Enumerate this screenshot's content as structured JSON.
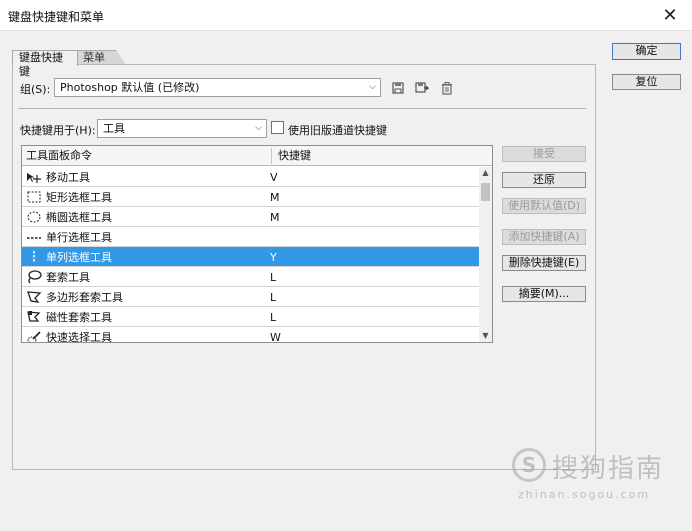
{
  "window": {
    "title": "键盘快捷键和菜单",
    "close_glyph": "✕"
  },
  "tabs": [
    {
      "label": "键盘快捷键",
      "active": true
    },
    {
      "label": "菜单",
      "active": false
    }
  ],
  "side_buttons": {
    "ok": "确定",
    "reset": "复位"
  },
  "group": {
    "label": "组(S):",
    "value": "Photoshop 默认值 (已修改)"
  },
  "shortcuts_for": {
    "label": "快捷键用于(H):",
    "value": "工具",
    "legacy_checkbox_label": "使用旧版通道快捷键",
    "legacy_checked": false
  },
  "table": {
    "col_command": "工具面板命令",
    "col_shortcut": "快捷键",
    "rows": [
      {
        "command": "移动工具",
        "shortcut": "V",
        "selected": false
      },
      {
        "command": "矩形选框工具",
        "shortcut": "M",
        "selected": false
      },
      {
        "command": "椭圆选框工具",
        "shortcut": "M",
        "selected": false
      },
      {
        "command": "单行选框工具",
        "shortcut": "",
        "selected": false
      },
      {
        "command": "单列选框工具",
        "shortcut": "Y",
        "selected": true
      },
      {
        "command": "套索工具",
        "shortcut": "L",
        "selected": false
      },
      {
        "command": "多边形套索工具",
        "shortcut": "L",
        "selected": false
      },
      {
        "command": "磁性套索工具",
        "shortcut": "L",
        "selected": false
      },
      {
        "command": "快速选择工具",
        "shortcut": "W",
        "selected": false
      }
    ]
  },
  "action_buttons": {
    "accept": "接受",
    "undo": "还原",
    "use_default": "使用默认值(D)",
    "add_shortcut": "添加快捷键(A)",
    "delete_shortcut": "删除快捷键(E)",
    "summarize": "摘要(M)..."
  },
  "watermark": {
    "logo_letter": "S",
    "text": "搜狗指南",
    "url": "zhinan.sogou.com"
  },
  "colors": {
    "selection": "#3399e5",
    "primary_border": "#3c78c8"
  }
}
